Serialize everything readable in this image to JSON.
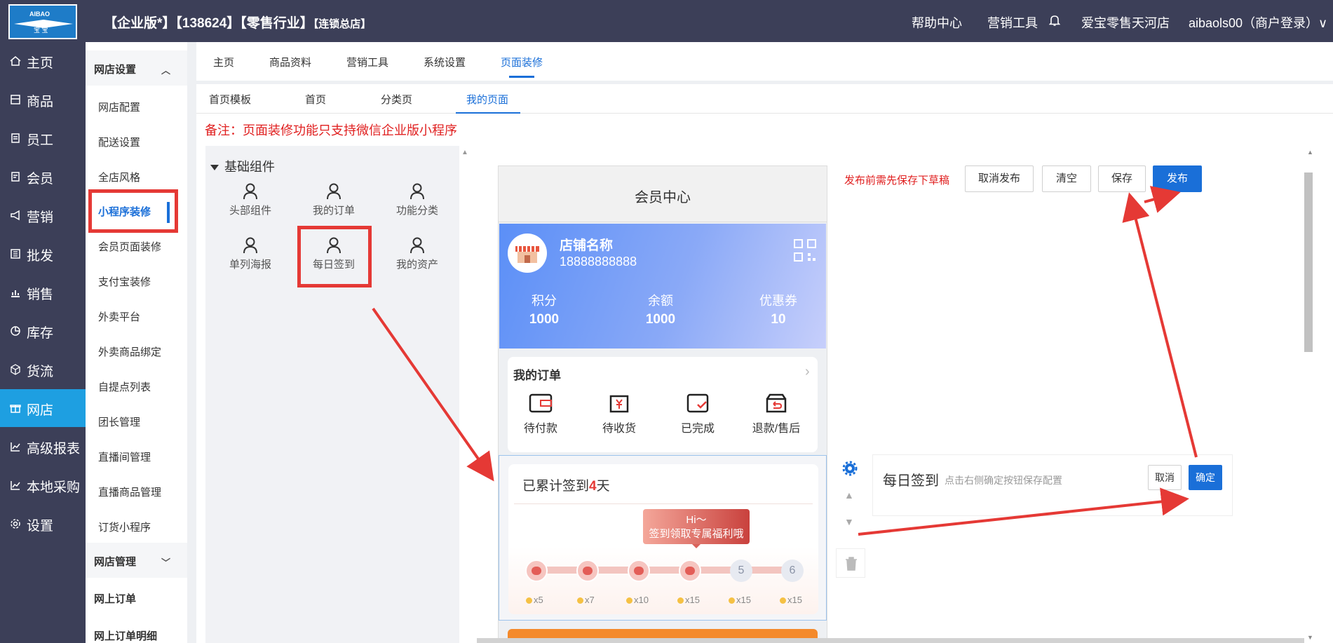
{
  "topbar": {
    "logo_top": "AIBAO",
    "logo_bottom": "宝 宝",
    "shop_title": "【企业版*】【138624】【零售行业】",
    "shop_title_small": "【连锁总店】",
    "help": "帮助中心",
    "marketing": "营销工具",
    "store": "爱宝零售天河店",
    "user": "aibaols00（商户登录）∨"
  },
  "leftnav": [
    {
      "label": "主页",
      "icon": "home-icon"
    },
    {
      "label": "商品",
      "icon": "product-icon"
    },
    {
      "label": "员工",
      "icon": "staff-icon"
    },
    {
      "label": "会员",
      "icon": "member-icon"
    },
    {
      "label": "营销",
      "icon": "megaphone-icon"
    },
    {
      "label": "批发",
      "icon": "wholesale-icon"
    },
    {
      "label": "销售",
      "icon": "sales-chart-icon"
    },
    {
      "label": "库存",
      "icon": "pie-chart-icon"
    },
    {
      "label": "货流",
      "icon": "cube-icon"
    },
    {
      "label": "网店",
      "icon": "gift-icon"
    },
    {
      "label": "高级报表",
      "icon": "line-chart-icon"
    },
    {
      "label": "本地采购",
      "icon": "line-chart-icon"
    },
    {
      "label": "设置",
      "icon": "gear-icon"
    }
  ],
  "subnav": {
    "group1": "网店设置",
    "items": [
      "网店配置",
      "配送设置",
      "全店风格",
      "小程序装修",
      "会员页面装修",
      "支付宝装修",
      "外卖平台",
      "外卖商品绑定",
      "自提点列表",
      "团长管理",
      "直播间管理",
      "直播商品管理",
      "订货小程序"
    ],
    "group2": "网店管理",
    "group2_items": [
      "网上订单",
      "网上订单明细"
    ]
  },
  "tabs": [
    "主页",
    "商品资料",
    "营销工具",
    "系统设置",
    "页面装修"
  ],
  "subtabs": [
    "首页模板",
    "首页",
    "分类页",
    "我的页面"
  ],
  "note": "备注：页面装修功能只支持微信企业版小程序",
  "components": {
    "header": "基础组件",
    "items": [
      "头部组件",
      "我的订单",
      "功能分类",
      "单列海报",
      "每日签到",
      "我的资产"
    ]
  },
  "phone": {
    "title": "会员中心",
    "store_name": "店铺名称",
    "store_phone": "18888888888",
    "stats": [
      {
        "label": "积分",
        "value": "1000"
      },
      {
        "label": "余额",
        "value": "1000"
      },
      {
        "label": "优惠券",
        "value": "10"
      }
    ],
    "orders_title": "我的订单",
    "orders": [
      "待付款",
      "待收货",
      "已完成",
      "退款/售后"
    ],
    "sign_prefix": "已累计签到",
    "sign_days": "4",
    "sign_suffix": "天",
    "bubble_line1": "Hi～",
    "bubble_line2": "签到领取专属福利哦",
    "days_todo": [
      "5",
      "6"
    ],
    "coins": [
      "x5",
      "x7",
      "x10",
      "x15",
      "x15",
      "x15"
    ]
  },
  "actions": {
    "hint": "发布前需先保存下草稿",
    "cancel_publish": "取消发布",
    "clear": "清空",
    "save": "保存",
    "publish": "发布"
  },
  "config": {
    "title": "每日签到",
    "hint": "点击右侧确定按钮保存配置",
    "cancel": "取消",
    "confirm": "确定"
  },
  "colors": {
    "sidebar": "#3c3f58",
    "active_nav": "#1e9fe1",
    "primary": "#1a6fd8",
    "annotation_red": "#e53935"
  }
}
